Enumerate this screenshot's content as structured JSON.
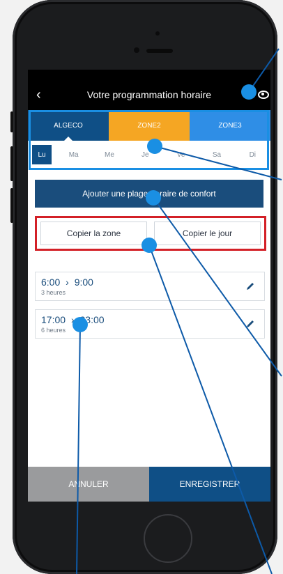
{
  "header": {
    "title": "Votre programmation horaire"
  },
  "zones": [
    {
      "label": "ALGECO"
    },
    {
      "label": "ZONE2"
    },
    {
      "label": "ZONE3"
    }
  ],
  "days": [
    "Lu",
    "Ma",
    "Me",
    "Je",
    "Ve",
    "Sa",
    "Di"
  ],
  "actions": {
    "add_label": "Ajouter une plage horaire de confort",
    "copy_zone": "Copier la zone",
    "copy_day": "Copier le jour"
  },
  "slots": [
    {
      "start": "6:00",
      "end": "9:00",
      "duration": "3 heures"
    },
    {
      "start": "17:00",
      "end": "23:00",
      "duration": "6 heures"
    }
  ],
  "footer": {
    "cancel": "ANNULER",
    "save": "ENREGISTRER"
  },
  "colors": {
    "primary": "#0f4f86",
    "zone2": "#f5a623",
    "zone3": "#2f8ee6",
    "highlight_blue": "#1a8fe3",
    "highlight_red": "#d32027",
    "callout_dot": "#1a8fe3"
  },
  "icons": {
    "back": "chevron-left-icon",
    "visibility": "eye-icon",
    "time_arrow": "chevron-right-icon",
    "edit": "pencil-icon"
  }
}
